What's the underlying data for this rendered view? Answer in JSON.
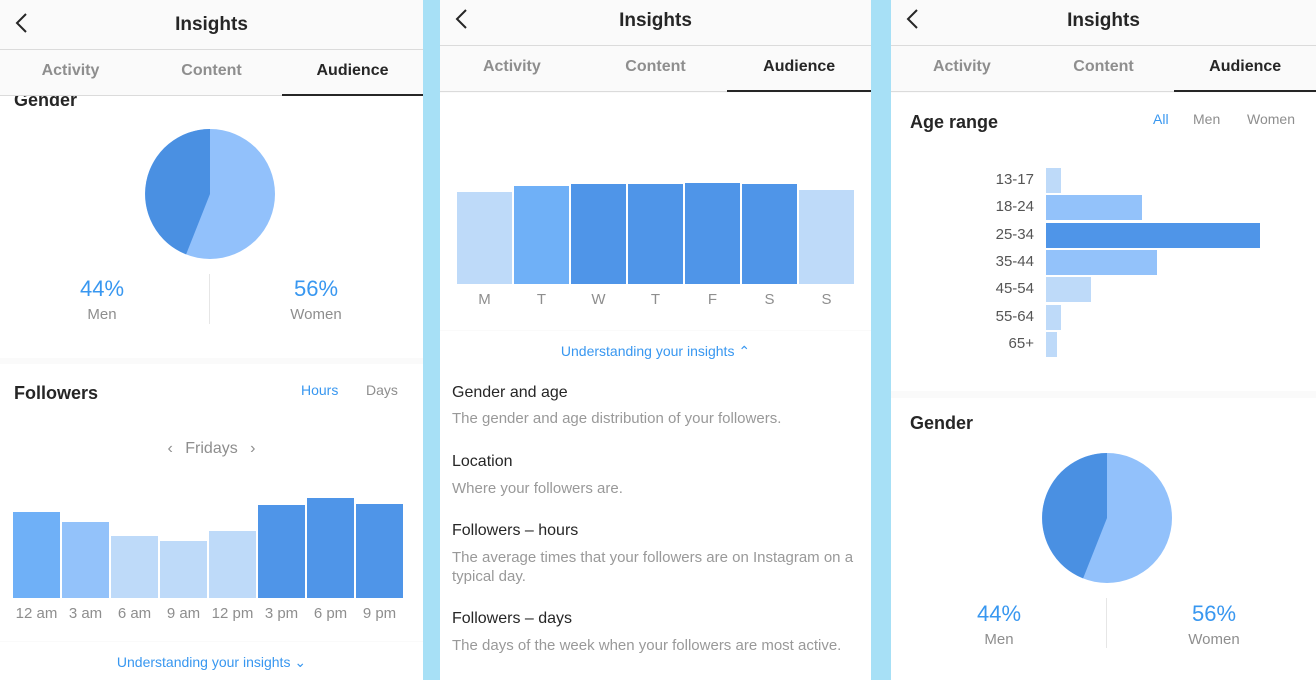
{
  "header": {
    "title": "Insights"
  },
  "tabs": [
    "Activity",
    "Content",
    "Audience"
  ],
  "colors": {
    "accent": "#3897f0",
    "bar_dark": "#4f95e8",
    "bar_mid": "#6fb0f7",
    "bar_light": "#93c2fa",
    "bar_pale": "#bedaf9",
    "pie_men": "#4a90e2",
    "pie_women": "#92c1fb"
  },
  "gender": {
    "title": "Gender",
    "men_pct": "44%",
    "men_label": "Men",
    "women_pct": "56%",
    "women_label": "Women",
    "men_value": 44,
    "women_value": 56
  },
  "followers": {
    "title": "Followers",
    "toggle_hours": "Hours",
    "toggle_days": "Days",
    "day_selector": "Fridays",
    "hours": [
      "12 am",
      "3 am",
      "6 am",
      "9 am",
      "12 pm",
      "3 pm",
      "6 pm",
      "9 pm"
    ],
    "hour_values": [
      86,
      76,
      62,
      57,
      67,
      93,
      100,
      94
    ],
    "days": [
      "M",
      "T",
      "W",
      "T",
      "F",
      "S",
      "S"
    ],
    "day_values": [
      92,
      98,
      100,
      100,
      101,
      100,
      94
    ]
  },
  "understanding": {
    "label": "Understanding your insights"
  },
  "info": [
    {
      "title": "Gender and age",
      "text": "The gender and age distribution of your followers."
    },
    {
      "title": "Location",
      "text": "Where your followers are."
    },
    {
      "title": "Followers – hours",
      "text": "The average times that your followers are on Instagram on a typical day."
    },
    {
      "title": "Followers – days",
      "text": "The days of the week when your followers are most active."
    }
  ],
  "age_range": {
    "title": "Age range",
    "filters": [
      "All",
      "Men",
      "Women"
    ],
    "groups": [
      "13-17",
      "18-24",
      "25-34",
      "35-44",
      "45-54",
      "55-64",
      "65+"
    ],
    "values": [
      7,
      45,
      100,
      52,
      21,
      7,
      5
    ]
  }
}
